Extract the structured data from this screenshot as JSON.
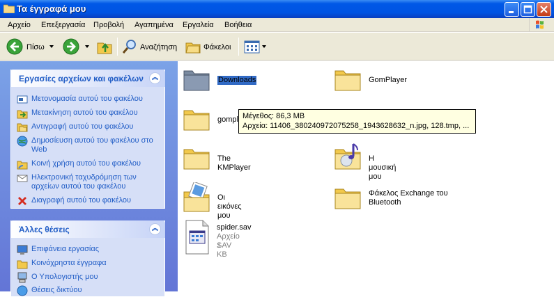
{
  "window": {
    "title": "Τα έγγραφά μου"
  },
  "menu": [
    "Αρχείο",
    "Επεξεργασία",
    "Προβολή",
    "Αγαπημένα",
    "Εργαλεία",
    "Βοήθεια"
  ],
  "toolbar": {
    "back_label": "Πίσω",
    "search_label": "Αναζήτηση",
    "folders_label": "Φάκελοι"
  },
  "left_pane": {
    "tasks_panel": {
      "title": "Εργασίες αρχείων και φακέλων",
      "items": [
        {
          "label": "Μετονομασία αυτού του φακέλου",
          "icon": "rename-icon"
        },
        {
          "label": "Μετακίνηση αυτού του φακέλου",
          "icon": "move-icon"
        },
        {
          "label": "Αντιγραφή αυτού του φακέλου",
          "icon": "copy-icon"
        },
        {
          "label": "Δημοσίευση αυτού του φακέλου στο Web",
          "icon": "publish-icon"
        },
        {
          "label": "Κοινή χρήση αυτού του φακέλου",
          "icon": "share-icon"
        },
        {
          "label": "Ηλεκτρονική ταχυδρόμηση των αρχείων αυτού του φακέλου",
          "icon": "email-icon"
        },
        {
          "label": "Διαγραφή αυτού του φακέλου",
          "icon": "delete-icon"
        }
      ]
    },
    "places_panel": {
      "title": "Άλλες θέσεις",
      "items": [
        {
          "label": "Επιφάνεια εργασίας",
          "icon": "desktop-icon"
        },
        {
          "label": "Κοινόχρηστα έγγραφα",
          "icon": "folder-icon"
        },
        {
          "label": "Ο Υπολογιστής μου",
          "icon": "computer-icon"
        },
        {
          "label": "Θέσεις δικτύου",
          "icon": "network-icon"
        }
      ]
    }
  },
  "files": [
    {
      "name": "Downloads",
      "type": "folder",
      "selected": true
    },
    {
      "name": "GomPlayer",
      "type": "folder"
    },
    {
      "name": "gomplayer",
      "type": "folder"
    },
    {
      "name": "The KMPlayer",
      "type": "folder"
    },
    {
      "name": "Η μουσική μου",
      "type": "music-folder"
    },
    {
      "name": "Οι εικόνες μου",
      "type": "pictures-folder"
    },
    {
      "name": "Φάκελος Exchange του Bluetooth",
      "type": "folder"
    },
    {
      "name": "spider.sav",
      "type": "file",
      "subtype": "Αρχείο SAV",
      "size": "1 KB"
    }
  ],
  "tooltip": {
    "line1": "Μέγεθος: 86,3 MB",
    "line2": "Αρχεία: 11406_380240972075258_1943628632_n.jpg, 128.tmp, ..."
  },
  "colors": {
    "titlebar": "#0054e3",
    "link": "#215dc6",
    "selection": "#316ac5",
    "tooltip_bg": "#ffffe1"
  }
}
